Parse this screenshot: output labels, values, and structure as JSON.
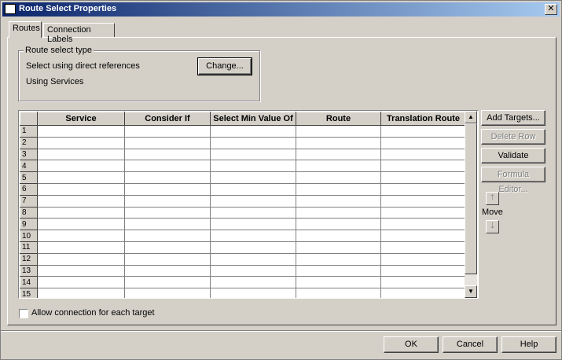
{
  "window": {
    "title": "Route Select Properties",
    "close_glyph": "✕"
  },
  "tabs": [
    {
      "label": "Routes"
    },
    {
      "label": "Connection Labels"
    }
  ],
  "route_select": {
    "group_label": "Route select type",
    "line1": "Select using direct references",
    "line2": "Using Services",
    "change_label": "Change..."
  },
  "grid": {
    "columns": [
      "Service",
      "Consider If",
      "Select Min Value Of",
      "Route",
      "Translation Route"
    ],
    "rows": [
      "1",
      "2",
      "3",
      "4",
      "5",
      "6",
      "7",
      "8",
      "9",
      "10",
      "11",
      "12",
      "13",
      "14",
      "15"
    ]
  },
  "side_buttons": {
    "add_targets": "Add Targets...",
    "delete_row": "Delete Row",
    "validate": "Validate",
    "formula_editor": "Formula Editor...",
    "move_label": "Move",
    "move_up_glyph": "🡑",
    "move_down_glyph": "🡓"
  },
  "checkbox": {
    "label": "Allow connection for each target",
    "checked": false
  },
  "footer": {
    "ok": "OK",
    "cancel": "Cancel",
    "help": "Help"
  },
  "scrollbar": {
    "up_glyph": "▲",
    "down_glyph": "▼"
  }
}
